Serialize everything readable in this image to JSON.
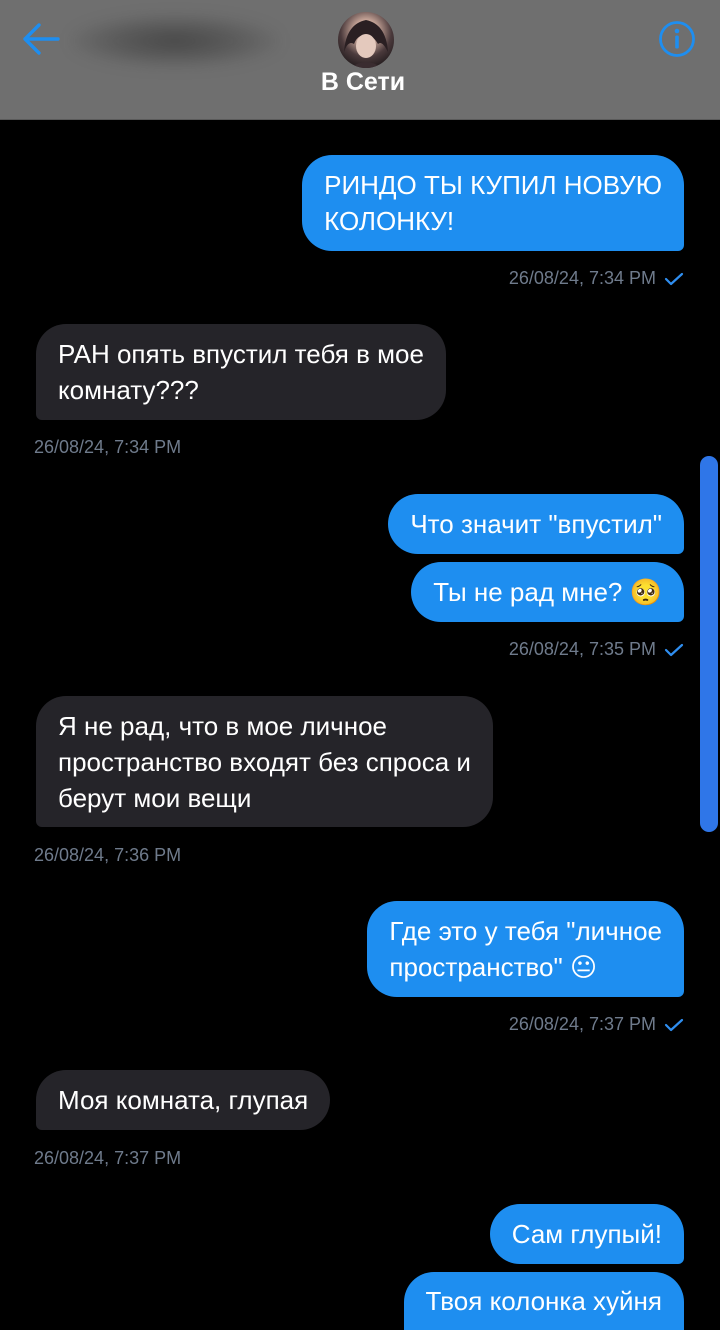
{
  "header": {
    "status": "В Сети",
    "back_icon": "arrow-left-icon",
    "info_icon": "info-icon",
    "accent": "#1e8ef0"
  },
  "messages": [
    {
      "dir": "out",
      "lines": [
        "РИНДО ТЫ КУПИЛ НОВУЮ",
        "КОЛОНКУ!"
      ]
    },
    {
      "dir": "out_ts",
      "time": "26/08/24, 7:34 PM"
    },
    {
      "dir": "in",
      "lines": [
        "РАН опять впустил тебя в мое",
        "комнату???"
      ]
    },
    {
      "dir": "in_ts",
      "time": "26/08/24, 7:34 PM"
    },
    {
      "dir": "out",
      "lines": [
        "Что значит \"впустил\""
      ]
    },
    {
      "dir": "out",
      "lines": [
        "Ты не рад мне? 🥺"
      ]
    },
    {
      "dir": "out_ts",
      "time": "26/08/24, 7:35 PM"
    },
    {
      "dir": "in",
      "lines": [
        "Я не рад, что в мое личное",
        "пространство входят без спроса и",
        "берут мои вещи"
      ]
    },
    {
      "dir": "in_ts",
      "time": "26/08/24, 7:36 PM"
    },
    {
      "dir": "out",
      "lines": [
        "Где это у тебя \"личное",
        "пространство\" 😐"
      ]
    },
    {
      "dir": "out_ts",
      "time": "26/08/24, 7:37 PM"
    },
    {
      "dir": "in",
      "lines": [
        "Моя комната, глупая"
      ]
    },
    {
      "dir": "in_ts",
      "time": "26/08/24, 7:37 PM"
    },
    {
      "dir": "out",
      "lines": [
        "Сам глупый!"
      ]
    },
    {
      "dir": "out",
      "lines": [
        "Твоя колонка хуйня"
      ]
    }
  ]
}
